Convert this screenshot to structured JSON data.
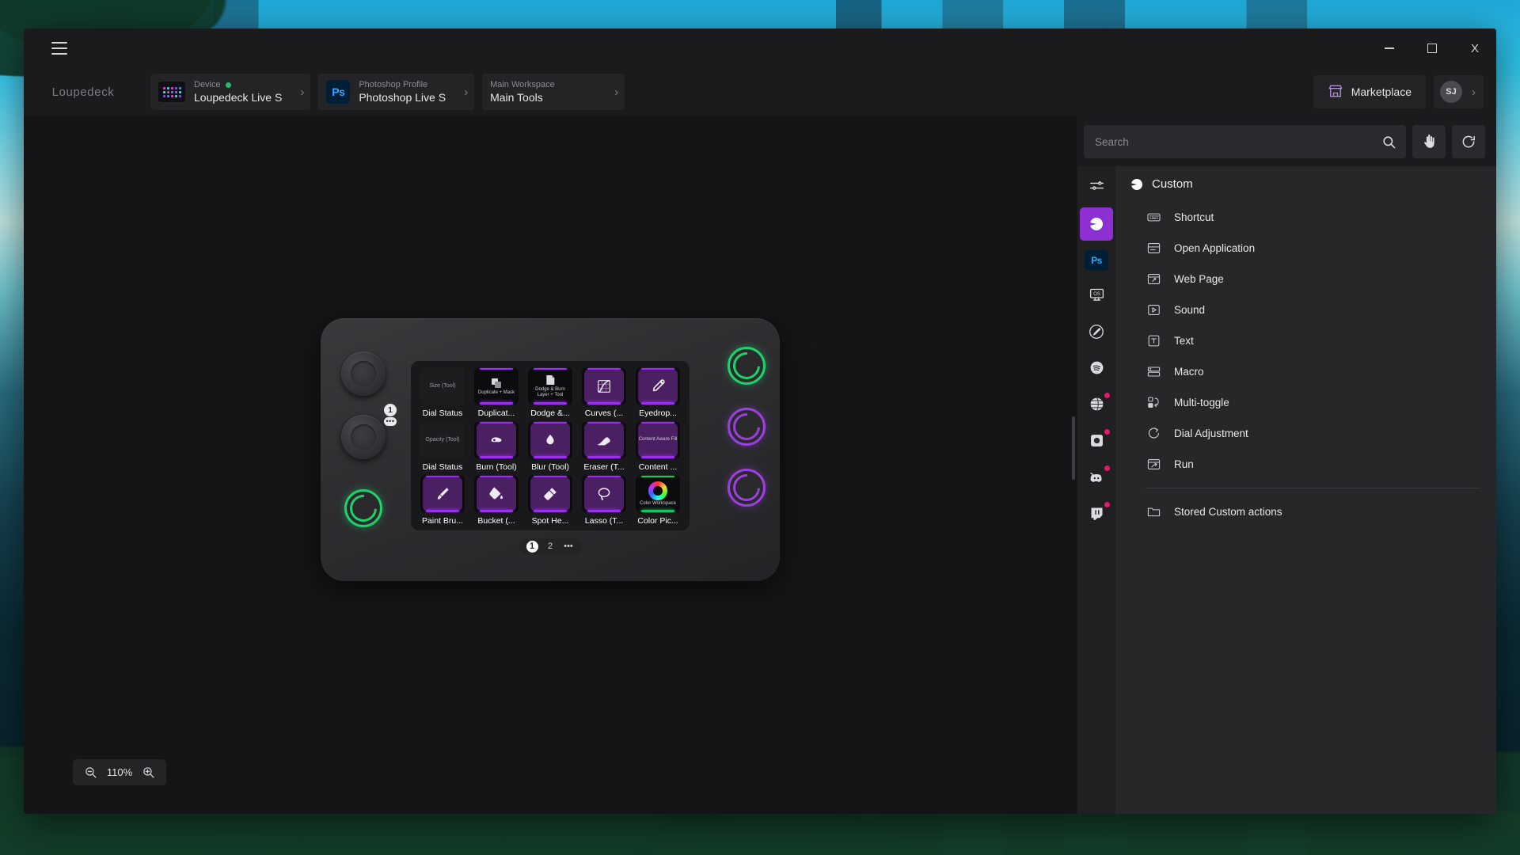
{
  "window": {
    "menu_icon": "hamburger-icon",
    "minimize_label": "_",
    "maximize_label": "□",
    "close_label": "X"
  },
  "brand": {
    "name": "Loupedeck"
  },
  "breadcrumbs": [
    {
      "label": "Device",
      "value": "Loupedeck Live S",
      "icon": "device-thumbnail-icon",
      "has_status_dot": true,
      "chevron": "›"
    },
    {
      "label": "Photoshop Profile",
      "value": "Photoshop Live S",
      "icon": "photoshop-icon",
      "icon_text": "Ps",
      "has_status_dot": false,
      "chevron": "›"
    },
    {
      "label": "Main Workspace",
      "value": "Main Tools",
      "icon": "none",
      "has_status_dot": false,
      "chevron": "›"
    }
  ],
  "top_right": {
    "marketplace_label": "Marketplace",
    "marketplace_icon": "storefront-icon",
    "avatar_initials": "SJ",
    "account_chevron": "›"
  },
  "search": {
    "placeholder": "Search",
    "value": "",
    "search_icon": "search-icon",
    "touch_icon": "touch-hand-icon",
    "reset_icon": "reset-circular-arrow-icon"
  },
  "icon_rail": [
    {
      "name": "sliders-icon",
      "active": false,
      "badge": false
    },
    {
      "name": "custom-pacman-icon",
      "active": true,
      "badge": false
    },
    {
      "name": "photoshop-icon",
      "active": false,
      "badge": false,
      "text": "Ps"
    },
    {
      "name": "os-monitor-icon",
      "active": false,
      "badge": false
    },
    {
      "name": "paintbrush-circle-icon",
      "active": false,
      "badge": false
    },
    {
      "name": "spotify-icon",
      "active": false,
      "badge": false
    },
    {
      "name": "browser-globe-icon",
      "active": false,
      "badge": true
    },
    {
      "name": "obs-camera-icon",
      "active": false,
      "badge": true
    },
    {
      "name": "discord-icon",
      "active": false,
      "badge": true
    },
    {
      "name": "twitch-icon",
      "active": false,
      "badge": true
    }
  ],
  "action_panel": {
    "header": {
      "title": "Custom",
      "icon": "custom-pacman-icon"
    },
    "items": [
      {
        "label": "Shortcut",
        "icon": "keyboard-icon"
      },
      {
        "label": "Open Application",
        "icon": "application-window-icon"
      },
      {
        "label": "Web Page",
        "icon": "web-page-icon"
      },
      {
        "label": "Sound",
        "icon": "play-sound-icon"
      },
      {
        "label": "Text",
        "icon": "text-t-icon"
      },
      {
        "label": "Macro",
        "icon": "macro-stack-icon"
      },
      {
        "label": "Multi-toggle",
        "icon": "multi-toggle-icon"
      },
      {
        "label": "Dial Adjustment",
        "icon": "dial-rotate-icon"
      },
      {
        "label": "Run",
        "icon": "run-window-icon"
      }
    ],
    "stored": {
      "label": "Stored Custom actions",
      "icon": "folder-icon"
    }
  },
  "device": {
    "dials": [
      {
        "name": "dial-top-left"
      },
      {
        "name": "dial-bottom-left"
      }
    ],
    "info_bubble": {
      "number": "1",
      "dots": "•••"
    },
    "round_buttons": [
      {
        "name": "round-button-left-bottom",
        "color": "#1fd16a"
      },
      {
        "name": "round-button-right-top",
        "color": "#1fd16a"
      },
      {
        "name": "round-button-right-middle",
        "color": "#9b3fe0"
      },
      {
        "name": "round-button-right-bottom",
        "color": "#9b3fe0"
      }
    ],
    "keys": [
      {
        "label": "Dial Status",
        "sub": "Size (Tool)",
        "type": "dialstatus",
        "icon": "none"
      },
      {
        "label": "Duplicat...",
        "sub": "Duplicate + Mask",
        "type": "thumb",
        "icon": "duplicate-layers-icon",
        "lit": "purple"
      },
      {
        "label": "Dodge &...",
        "sub": "Dodge & Burn Layer + Tool",
        "type": "thumb",
        "icon": "dodge-burn-icon",
        "lit": "purple"
      },
      {
        "label": "Curves (...",
        "sub": "",
        "type": "icon",
        "icon": "curves-icon",
        "lit": "purple"
      },
      {
        "label": "Eyedrop...",
        "sub": "",
        "type": "icon",
        "icon": "eyedropper-icon",
        "lit": "purple"
      },
      {
        "label": "Dial Status",
        "sub": "Opacity (Tool)",
        "type": "dialstatus",
        "icon": "none"
      },
      {
        "label": "Burn (Tool)",
        "sub": "",
        "type": "icon",
        "icon": "burn-hand-icon",
        "lit": "purple"
      },
      {
        "label": "Blur (Tool)",
        "sub": "",
        "type": "icon",
        "icon": "blur-droplet-icon",
        "lit": "purple"
      },
      {
        "label": "Eraser (T...",
        "sub": "",
        "type": "icon",
        "icon": "eraser-icon",
        "lit": "purple"
      },
      {
        "label": "Content ...",
        "sub": "Content Aware Fill",
        "type": "thumb",
        "icon": "content-aware-fill-icon",
        "lit": "purple"
      },
      {
        "label": "Paint Bru...",
        "sub": "",
        "type": "icon",
        "icon": "paintbrush-icon",
        "lit": "purple"
      },
      {
        "label": "Bucket (...",
        "sub": "",
        "type": "icon",
        "icon": "paint-bucket-icon",
        "lit": "purple"
      },
      {
        "label": "Spot He...",
        "sub": "",
        "type": "icon",
        "icon": "spot-healing-brush-icon",
        "lit": "purple"
      },
      {
        "label": "Lasso (T...",
        "sub": "",
        "type": "icon",
        "icon": "lasso-icon",
        "lit": "purple"
      },
      {
        "label": "Color Pic...",
        "sub": "Color Workspace",
        "type": "colorwheel",
        "icon": "color-wheel-icon",
        "lit": "green"
      }
    ],
    "pages": [
      {
        "label": "1",
        "active": true
      },
      {
        "label": "2",
        "active": false
      },
      {
        "label": "•••",
        "active": false
      }
    ]
  },
  "zoom_control": {
    "value": "110%",
    "zoom_out_icon": "zoom-out-icon",
    "zoom_in_icon": "zoom-in-icon"
  },
  "colors": {
    "accent_purple": "#8c30d4",
    "led_purple": "#9b2ff0",
    "led_green": "#16c55f",
    "badge_red": "#e8176b",
    "panel_bg": "#27272a",
    "window_bg": "#1b1b1d"
  }
}
